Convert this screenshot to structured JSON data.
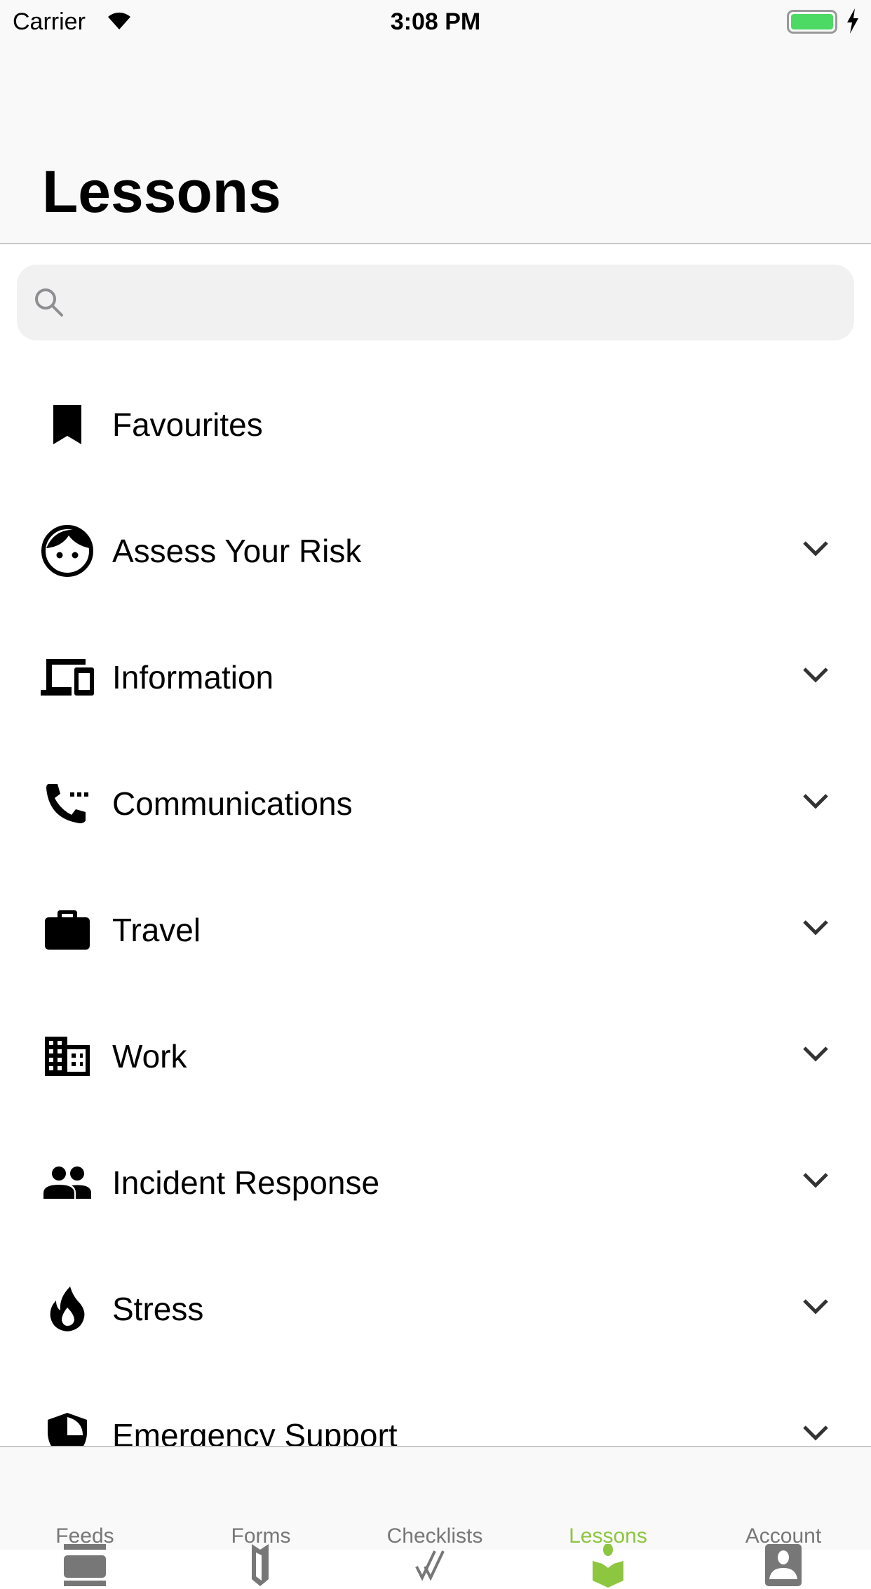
{
  "status_bar": {
    "carrier": "Carrier",
    "time": "3:08 PM",
    "battery_color": "#4cd964"
  },
  "header": {
    "title": "Lessons"
  },
  "search": {
    "placeholder": ""
  },
  "items": [
    {
      "label": "Favourites",
      "icon": "bookmark-icon",
      "expandable": false
    },
    {
      "label": "Assess Your Risk",
      "icon": "face-icon",
      "expandable": true
    },
    {
      "label": "Information",
      "icon": "devices-icon",
      "expandable": true
    },
    {
      "label": "Communications",
      "icon": "phone-icon",
      "expandable": true
    },
    {
      "label": "Travel",
      "icon": "briefcase-icon",
      "expandable": true
    },
    {
      "label": "Work",
      "icon": "building-icon",
      "expandable": true
    },
    {
      "label": "Incident Response",
      "icon": "people-icon",
      "expandable": true
    },
    {
      "label": "Stress",
      "icon": "flame-icon",
      "expandable": true
    },
    {
      "label": "Emergency Support",
      "icon": "shield-icon",
      "expandable": true
    }
  ],
  "tabs": [
    {
      "label": "Feeds",
      "icon": "feeds-icon"
    },
    {
      "label": "Forms",
      "icon": "map-icon"
    },
    {
      "label": "Checklists",
      "icon": "double-check-icon"
    },
    {
      "label": "Lessons",
      "icon": "reader-icon",
      "active": true
    },
    {
      "label": "Account",
      "icon": "account-icon"
    }
  ],
  "colors": {
    "accent": "#8dc63f",
    "inactive": "#777777"
  }
}
